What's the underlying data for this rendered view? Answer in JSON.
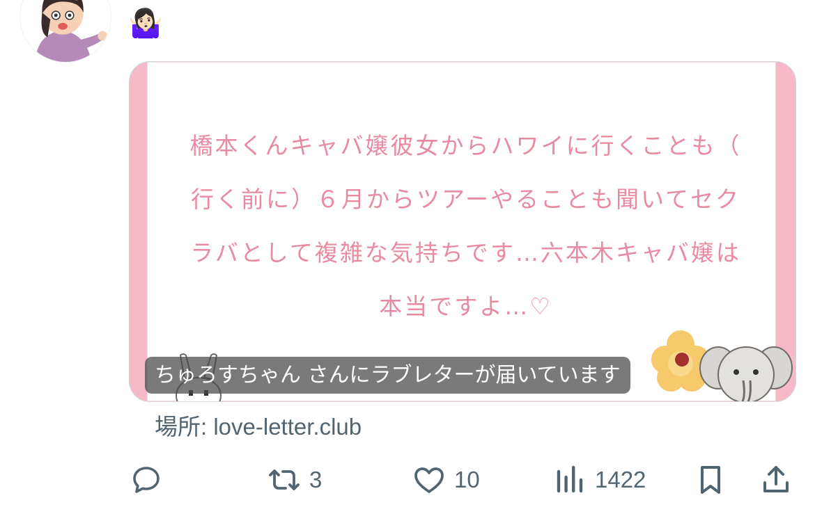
{
  "tweet": {
    "avatar_icon": "shrugging-woman-avatar",
    "text": "🤷🏻‍♀️"
  },
  "card": {
    "letter_text": "橋本くんキャバ嬢彼女からハワイに行くことも（\n行く前に）６月からツアーやることも聞いてセク\nラバとして複雑な気持ちです…六本木キャバ嬢は\n本当ですよ…♡",
    "caption": "ちゅろすちゃん さんにラブレターが届いています",
    "frame_color": "#f5b9c8",
    "text_color": "#e98ba0"
  },
  "source_label": "場所: love-letter.club",
  "actions": {
    "reply_icon": "reply-icon",
    "retweet_count": "3",
    "like_count": "10",
    "views_count": "1422",
    "bookmark_icon": "bookmark-icon",
    "share_icon": "share-icon"
  },
  "colors": {
    "action_gray": "#536471"
  }
}
